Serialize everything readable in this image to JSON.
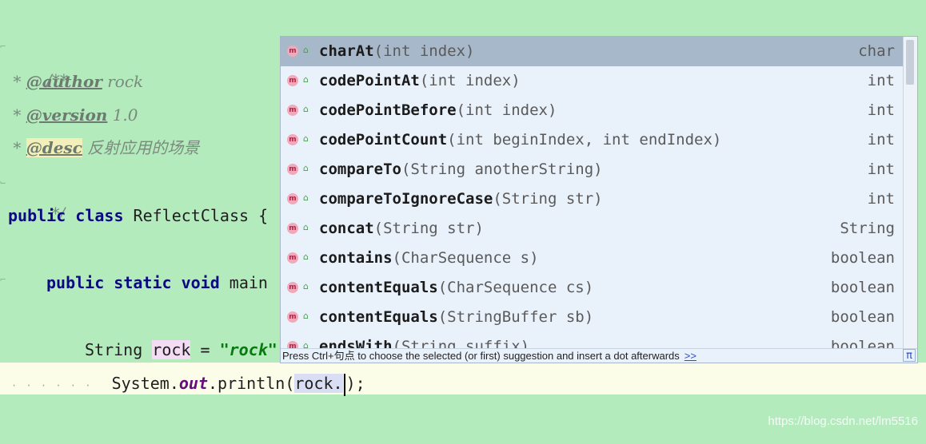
{
  "editor": {
    "doc_open": "/**",
    "author_tag": "@author",
    "author_value": " rock",
    "version_tag": "@version",
    "version_value": " 1.0",
    "desc_tag": "@desc",
    "desc_value": " 反射应用的场景",
    "doc_close": " */",
    "comment_star": " * ",
    "kw_public": "public",
    "kw_class": "class",
    "class_name": " ReflectClass {",
    "kw_static": "static",
    "kw_void": "void",
    "main_text": " main",
    "string_type": "String ",
    "var_name": "rock",
    "assign": " = ",
    "string_literal": "\"rock\"",
    "indent_dots": "· · · · · ·",
    "system": "System.",
    "out_field": "out",
    "println": ".println(",
    "arg": "rock.",
    "close": ");"
  },
  "completion": {
    "items": [
      {
        "name": "charAt",
        "params": "(int index)",
        "type": "char"
      },
      {
        "name": "codePointAt",
        "params": "(int index)",
        "type": "int"
      },
      {
        "name": "codePointBefore",
        "params": "(int index)",
        "type": "int"
      },
      {
        "name": "codePointCount",
        "params": "(int beginIndex, int endIndex)",
        "type": "int"
      },
      {
        "name": "compareTo",
        "params": "(String anotherString)",
        "type": "int"
      },
      {
        "name": "compareToIgnoreCase",
        "params": "(String str)",
        "type": "int"
      },
      {
        "name": "concat",
        "params": "(String str)",
        "type": "String"
      },
      {
        "name": "contains",
        "params": "(CharSequence s)",
        "type": "boolean"
      },
      {
        "name": "contentEquals",
        "params": "(CharSequence cs)",
        "type": "boolean"
      },
      {
        "name": "contentEquals",
        "params": "(StringBuffer sb)",
        "type": "boolean"
      },
      {
        "name": "endsWith",
        "params": "(String suffix)",
        "type": "boolean"
      }
    ],
    "method_icon": "m-method-icon",
    "visibility_icon": "public-lock-icon",
    "footer_text": "Press Ctrl+句点 to choose the selected (or first) suggestion and insert a dot afterwards",
    "footer_link": ">>",
    "pi_label": "π"
  },
  "watermark": "https://blog.csdn.net/lm5516",
  "colors": {
    "editor_bg": "#b3ebbd",
    "caret_line_bg": "#fbfde8",
    "popup_bg": "#e9f1fb",
    "selected_bg": "#a6b8c9",
    "keyword": "#0a0a80",
    "string": "#0a7a10",
    "field": "#660e7a"
  }
}
